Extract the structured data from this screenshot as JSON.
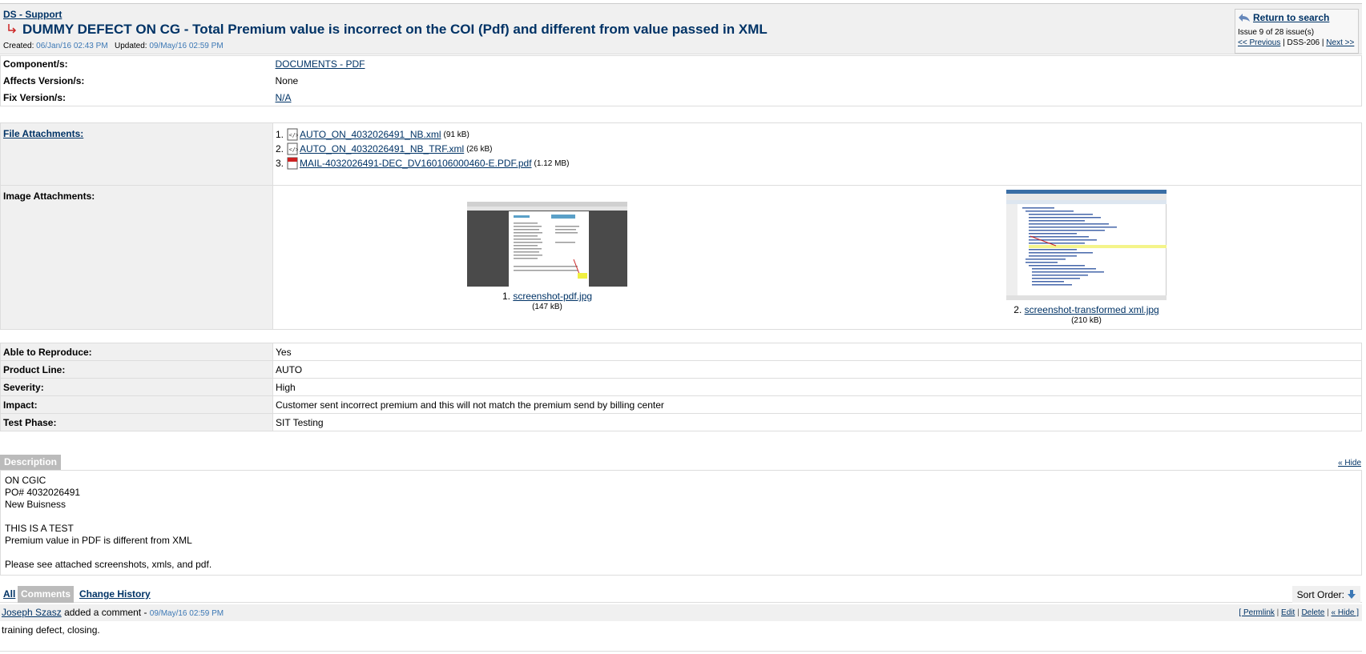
{
  "header": {
    "project_link": "DS - Support",
    "title": "DUMMY DEFECT ON CG - Total Premium value is incorrect on the COI (Pdf) and different from value passed in XML",
    "created_label": "Created:",
    "created_value": "06/Jan/16 02:43 PM",
    "updated_label": "Updated:",
    "updated_value": "09/May/16 02:59 PM"
  },
  "nav": {
    "return_label": "Return to search",
    "issue_position": "Issue 9 of 28 issue(s)",
    "previous": "<< Previous",
    "separator": "|",
    "key": "DSS-206",
    "next": "Next >>"
  },
  "fields_top": [
    {
      "label": "Component/s:",
      "value": "DOCUMENTS - PDF",
      "is_link": true
    },
    {
      "label": "Affects Version/s:",
      "value": "None",
      "is_link": false
    },
    {
      "label": "Fix Version/s:",
      "value": "N/A",
      "is_link": true
    }
  ],
  "file_attachments": {
    "label": "File Attachments:",
    "items": [
      {
        "num": "1.",
        "name": "AUTO_ON_4032026491_NB.xml",
        "size": "(91 kB)",
        "icon": "xml-file-icon"
      },
      {
        "num": "2.",
        "name": "AUTO_ON_4032026491_NB_TRF.xml",
        "size": "(26 kB)",
        "icon": "xml-file-icon"
      },
      {
        "num": "3.",
        "name": "MAIL-4032026491-DEC_DV160106000460-E.PDF.pdf",
        "size": "(1.12 MB)",
        "icon": "pdf-file-icon"
      }
    ]
  },
  "image_attachments": {
    "label": "Image Attachments:",
    "items": [
      {
        "num": "1.",
        "name": "screenshot-pdf.jpg",
        "size": "(147 kB)"
      },
      {
        "num": "2.",
        "name": "screenshot-transformed xml.jpg",
        "size": "(210 kB)"
      }
    ]
  },
  "fields_bottom": [
    {
      "label": "Able to Reproduce:",
      "value": "Yes"
    },
    {
      "label": "Product Line:",
      "value": "AUTO"
    },
    {
      "label": "Severity:",
      "value": "High"
    },
    {
      "label": "Impact:",
      "value": "Customer sent incorrect premium and this will not match the premium send by billing center"
    },
    {
      "label": "Test Phase:",
      "value": "SIT Testing"
    }
  ],
  "description": {
    "tab_label": "Description",
    "hide_label": "« Hide",
    "lines": [
      "ON CGIC",
      "PO# 4032026491",
      "New Buisness",
      "",
      "THIS IS A TEST",
      "Premium value in PDF is different from XML",
      "",
      "Please see attached screenshots, xmls, and pdf."
    ]
  },
  "activity_tabs": {
    "all": "All",
    "comments": "Comments",
    "history": "Change History",
    "sort_label": "Sort Order:"
  },
  "comment": {
    "author": "Joseph Szasz",
    "action": "added a comment -",
    "date": "09/May/16 02:59 PM",
    "actions": [
      "[ Permlink",
      "|",
      "Edit",
      "|",
      "Delete",
      "|",
      "« Hide ]"
    ],
    "body": "training defect, closing."
  }
}
